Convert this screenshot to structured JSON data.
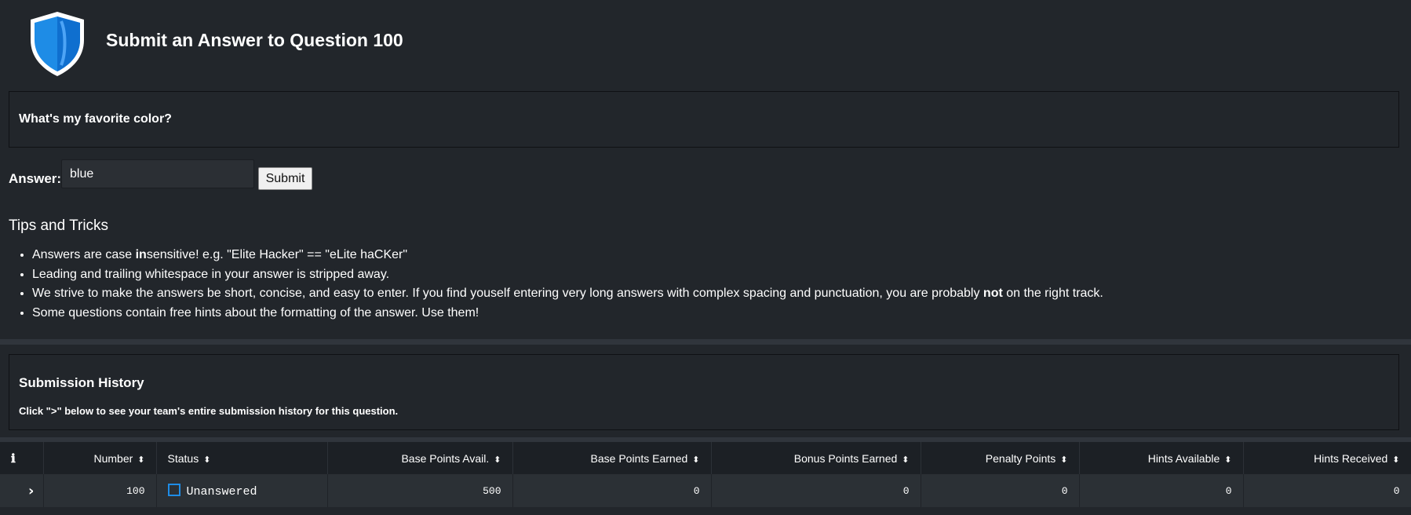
{
  "header": {
    "title": "Submit an Answer to Question 100",
    "logo_icon": "shield-icon",
    "logo_color": "#1e8ce6"
  },
  "question": {
    "text": "What's my favorite color?"
  },
  "answer_form": {
    "label": "Answer:",
    "value": "blue",
    "submit_label": "Submit"
  },
  "tips": {
    "heading": "Tips and Tricks",
    "items": [
      {
        "before": "Answers are case ",
        "bold": "in",
        "after": "sensitive! e.g. \"Elite Hacker\" == \"eLite haCKer\""
      },
      {
        "before": "Leading and trailing whitespace in your answer is stripped away.",
        "bold": "",
        "after": ""
      },
      {
        "before": "We strive to make the answers be short, concise, and easy to enter. If you find youself entering very long answers with complex spacing and punctuation, you are probably ",
        "bold": "not",
        "after": " on the right track."
      },
      {
        "before": "Some questions contain free hints about the formatting of the answer. Use them!",
        "bold": "",
        "after": ""
      }
    ]
  },
  "history": {
    "title": "Submission History",
    "hint": "Click \">\" below to see your team's entire submission history for this question."
  },
  "table": {
    "info_icon": "info-icon",
    "info_glyph": "ℹ",
    "sort_glyph": "⬍",
    "columns": [
      "Number",
      "Status",
      "Base Points Avail.",
      "Base Points Earned",
      "Bonus Points Earned",
      "Penalty Points",
      "Hints Available",
      "Hints Received"
    ],
    "rows": [
      {
        "expander": "›",
        "number": "100",
        "status": "Unanswered",
        "base_points_avail": "500",
        "base_points_earned": "0",
        "bonus_points_earned": "0",
        "penalty_points": "0",
        "hints_available": "0",
        "hints_received": "0"
      }
    ]
  }
}
